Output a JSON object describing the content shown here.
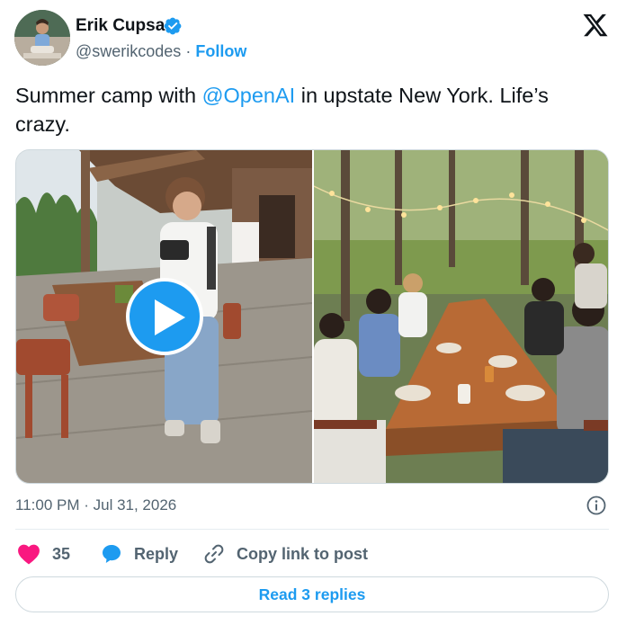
{
  "author": {
    "name": "Erik Cupsa",
    "handle": "@swerikcodes",
    "separator": "·",
    "follow_label": "Follow"
  },
  "tweet": {
    "text_before": "Summer camp with ",
    "mention": "@OpenAI",
    "text_after": " in upstate New York. Life’s crazy."
  },
  "media": {
    "left": {
      "kind": "video",
      "description_icon": "play-icon"
    },
    "right": {
      "kind": "photo"
    }
  },
  "meta": {
    "timestamp": "11:00 PM · Jul 31, 2026"
  },
  "actions": {
    "likes_count": "35",
    "reply_label": "Reply",
    "copy_label": "Copy link to post"
  },
  "footer": {
    "read_replies_label": "Read 3 replies"
  },
  "colors": {
    "accent": "#1d9bf0",
    "heart": "#f91880",
    "text": "#0f1419",
    "muted": "#536471",
    "border": "#cfd9de"
  }
}
